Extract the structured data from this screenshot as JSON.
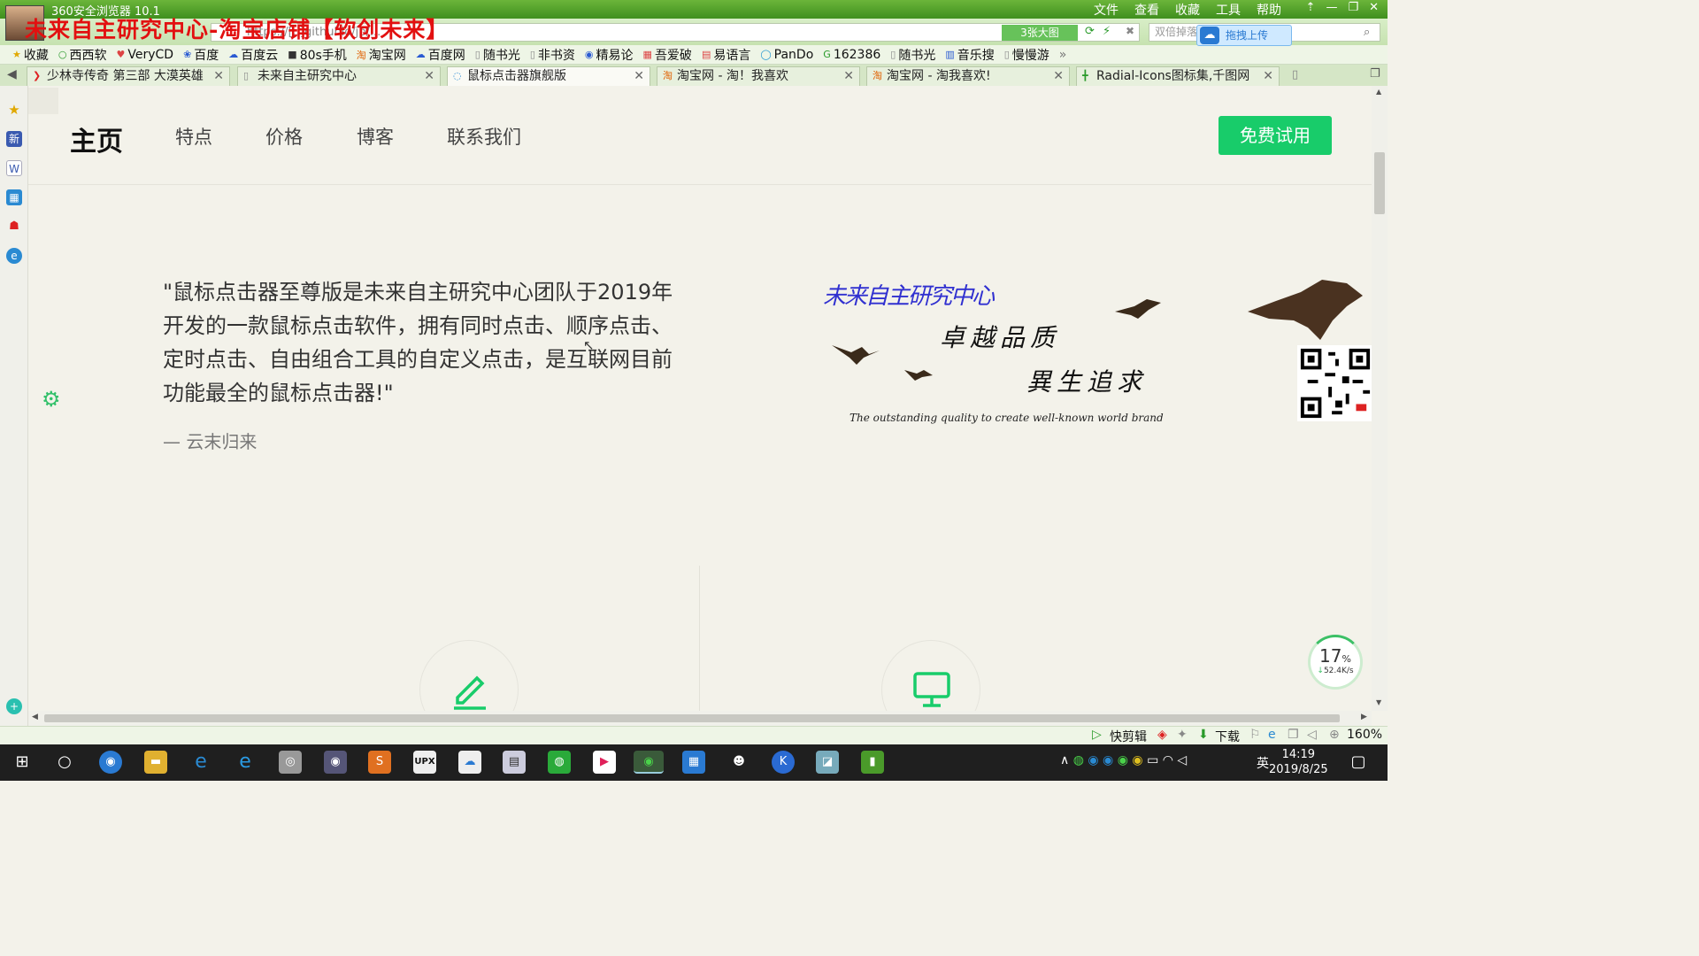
{
  "browser": {
    "title": "360安全浏览器 10.1",
    "menu": [
      "文件",
      "查看",
      "收藏",
      "工具",
      "帮助"
    ],
    "overlay_title": "未来自主研究中心-淘宝店铺【软创未来】",
    "url": "https://[..]githubio/jp/...",
    "big_image_btn": "3张大图",
    "search_placeholder": "双倍掉落",
    "upload_btn": "拖拽上传"
  },
  "bookmarks": [
    "收藏",
    "西西软",
    "VeryCD",
    "百度",
    "百度云",
    "80s手机",
    "淘宝网",
    "百度网",
    "随书光",
    "非书资",
    "精易论",
    "吾爱破",
    "易语言",
    "PanDo",
    "162386",
    "随书光",
    "音乐搜",
    "慢慢游"
  ],
  "tabs": [
    {
      "label": "少林寺传奇 第三部 大漠英雄",
      "active": false
    },
    {
      "label": "未来自主研究中心",
      "active": false
    },
    {
      "label": "鼠标点击器旗舰版",
      "active": true
    },
    {
      "label": "淘宝网 - 淘！我喜欢",
      "active": false
    },
    {
      "label": "淘宝网 - 淘我喜欢!",
      "active": false
    },
    {
      "label": "Radial-Icons图标集,千图网",
      "active": false
    }
  ],
  "page": {
    "nav": {
      "brand": "主页",
      "links": [
        "特点",
        "价格",
        "博客",
        "联系我们"
      ],
      "cta": "免费试用"
    },
    "quote": "\"鼠标点击器至尊版是未来自主研究中心团队于2019年开发的一款鼠标点击软件，拥有同时点击、顺序点击、定时点击、自由组合工具的自定义点击，是互联网目前功能最全的鼠标点击器!\"",
    "author": "— 云末归来",
    "banner": {
      "brand": "未来自主研究中心",
      "line1": "卓越品质",
      "line2": "異生追求",
      "english": "The outstanding quality to create well-known world brand"
    }
  },
  "speed_widget": {
    "percent": "17",
    "unit": "%",
    "rate": "52.4K/s"
  },
  "statusbar": {
    "clip": "快剪辑",
    "download": "下载",
    "zoom": "160%"
  },
  "taskbar": {
    "time": "14:19",
    "date": "2019/8/25",
    "ime": "英"
  },
  "colors": {
    "accent_green": "#18cc6a",
    "titlebar_green": "#4a9a26",
    "overlay_red": "#e21010"
  }
}
